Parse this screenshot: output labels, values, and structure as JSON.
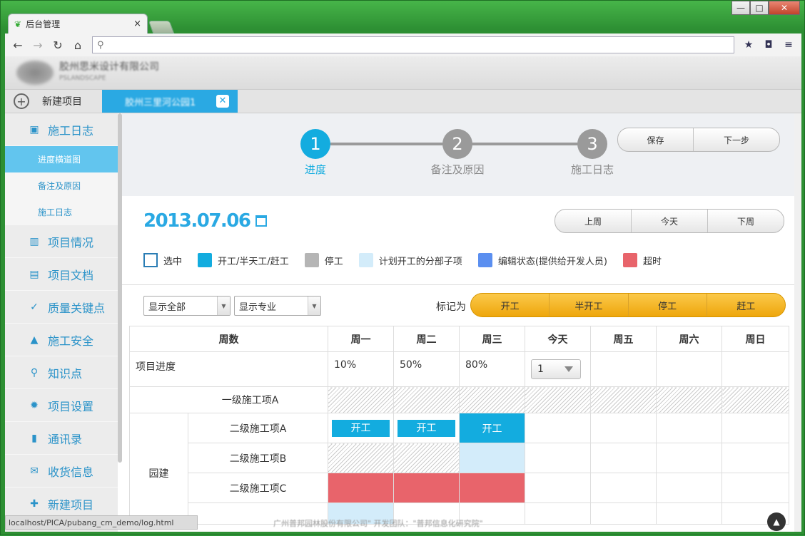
{
  "browser": {
    "tab_title": "后台管理",
    "tab_close": "×",
    "window_controls": {
      "minimize": "—",
      "maximize": "□",
      "close": "✕"
    },
    "address_value": ""
  },
  "app": {
    "company_name": "胶州思米设计有限公司",
    "company_sub": "PSLANDSCAPE",
    "new_project_label": "新建项目",
    "project_tab": "胶州三里河公园1",
    "project_tab_close": "✕"
  },
  "sidebar": {
    "items": [
      {
        "label": "施工日志",
        "icon": "log-icon"
      },
      {
        "label": "项目情况",
        "icon": "chart-icon"
      },
      {
        "label": "项目文档",
        "icon": "doc-icon"
      },
      {
        "label": "质量关键点",
        "icon": "check-icon"
      },
      {
        "label": "施工安全",
        "icon": "warning-icon"
      },
      {
        "label": "知识点",
        "icon": "search-doc-icon"
      },
      {
        "label": "项目设置",
        "icon": "gear-icon"
      },
      {
        "label": "通讯录",
        "icon": "contacts-icon"
      },
      {
        "label": "收货信息",
        "icon": "mail-icon"
      },
      {
        "label": "新建项目",
        "icon": "new-icon"
      }
    ],
    "subitems": [
      "进度横道图",
      "备注及原因",
      "施工日志"
    ]
  },
  "steps": [
    {
      "num": "1",
      "label": "进度"
    },
    {
      "num": "2",
      "label": "备注及原因"
    },
    {
      "num": "3",
      "label": "施工日志"
    }
  ],
  "step_buttons": {
    "save": "保存",
    "next": "下一步"
  },
  "date": "2013.07.06",
  "week_buttons": {
    "prev": "上周",
    "today": "今天",
    "next": "下周"
  },
  "legend": [
    {
      "label": "选中",
      "color": "#ffffff"
    },
    {
      "label": "开工/半天工/赶工",
      "color": "#13acdf"
    },
    {
      "label": "停工",
      "color": "#b5b5b5"
    },
    {
      "label": "计划开工的分部子项",
      "color": "#d3ecfa"
    },
    {
      "label": "编辑状态(提供给开发人员)",
      "color": "#5b8ff0"
    },
    {
      "label": "超时",
      "color": "#e8646b"
    }
  ],
  "filters": {
    "show_all": "显示全部",
    "show_major": "显示专业"
  },
  "mark": {
    "label": "标记为",
    "buttons": [
      "开工",
      "半开工",
      "停工",
      "赶工"
    ]
  },
  "table": {
    "headers": [
      "周数",
      "周一",
      "周二",
      "周三",
      "今天",
      "周五",
      "周六",
      "周日"
    ],
    "progress_label": "项目进度",
    "progress": [
      "10%",
      "50%",
      "80%"
    ],
    "today_select": "1",
    "level1": "一级施工项A",
    "group": "园建",
    "level2": [
      "二级施工项A",
      "二级施工项B",
      "二级施工项C"
    ],
    "start_label": "开工"
  },
  "status": {
    "url": "localhost/PICA/pubang_cm_demo/log.html",
    "footer": "广州普邦园林股份有限公司\"    开发团队：\"普邦信息化研究院\"",
    "up": "▲"
  }
}
